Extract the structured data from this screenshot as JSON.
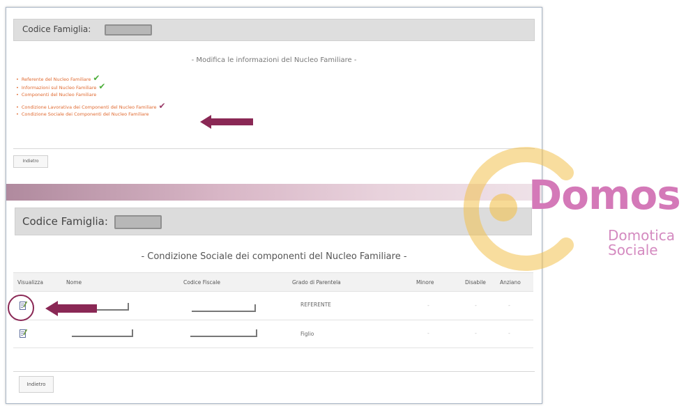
{
  "top_panel": {
    "family_code_label": "Codice Famiglia:",
    "section_title": "- Modifica le informazioni del Nucleo Familiare -",
    "links": [
      {
        "label": "Referente del Nucleo Familiare",
        "checked": true
      },
      {
        "label": "Informazioni sul Nucleo Familiare",
        "checked": true
      },
      {
        "label": "Componenti del Nucleo Familiare",
        "checked": false
      },
      {
        "label": "Condizione Lavorativa dei Componenti del Nucleo Familiare",
        "checked": true
      },
      {
        "label": "Condizione Sociale dei Componenti del Nucleo Familiare",
        "checked": false
      }
    ],
    "back_label": "Indietro"
  },
  "bottom_panel": {
    "family_code_label": "Codice Famiglia:",
    "section_title": "- Condizione Sociale dei componenti del Nucleo Familiare -",
    "columns": [
      "Visualizza",
      "Nome",
      "Codice Fiscale",
      "Grado di Parentela",
      "Minore",
      "Disabile",
      "Anziano"
    ],
    "rows": [
      {
        "relation": "REFERENTE",
        "minore": "-",
        "disabile": "-",
        "anziano": "-"
      },
      {
        "relation": "Figlio",
        "minore": "-",
        "disabile": "-",
        "anziano": "-"
      }
    ],
    "back_label": "Indietro"
  },
  "watermark": {
    "brand": "Domos",
    "tagline_1": "Domotica",
    "tagline_2": "Sociale"
  },
  "colors": {
    "link": "#e0692f",
    "check": "#4cae3a",
    "arrow": "#8a2855",
    "logo_pink": "#d479b8",
    "logo_yellow": "#f2c14e"
  },
  "icons": [
    "check-icon",
    "edit-icon",
    "arrow-icon"
  ]
}
